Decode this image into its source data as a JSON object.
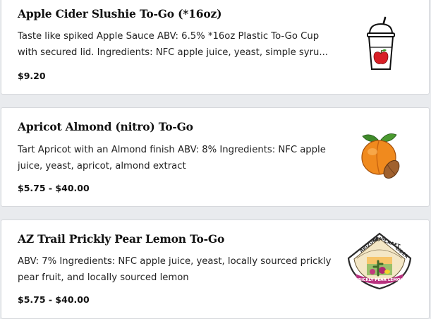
{
  "menu_items": [
    {
      "title": "Apple Cider Slushie To-Go (*16oz)",
      "description_lines": [
        "Taste like spiked Apple Sauce ABV: 6.5% *16oz Plastic To-Go Cup",
        "with secured lid. Ingredients: NFC apple juice, yeast, simple syru..."
      ],
      "price": "$9.20",
      "image_icon": "slushie-cup-icon"
    },
    {
      "title": "Apricot Almond (nitro) To-Go",
      "description_lines": [
        "Tart Apricot with an Almond finish ABV: 8% Ingredients: NFC apple",
        "juice, yeast, apricot, almond extract"
      ],
      "price": "$5.75 - $40.00",
      "image_icon": "apricot-almond-icon"
    },
    {
      "title": "AZ Trail Prickly Pear Lemon To-Go",
      "description_lines": [
        "ABV: 7% Ingredients: NFC apple juice, yeast, locally sourced prickly",
        "pear fruit, and locally sourced lemon"
      ],
      "price": "$5.75 - $40.00",
      "image_icon": "az-trail-badge-icon",
      "badge_text": [
        "ARIZONA",
        "TRAIL",
        "CRAFT",
        "CIDER",
        "PRICKLY PEAR LEMON"
      ]
    }
  ],
  "colors": {
    "background": "#e9ebee",
    "card": "#ffffff",
    "text": "#111111"
  }
}
